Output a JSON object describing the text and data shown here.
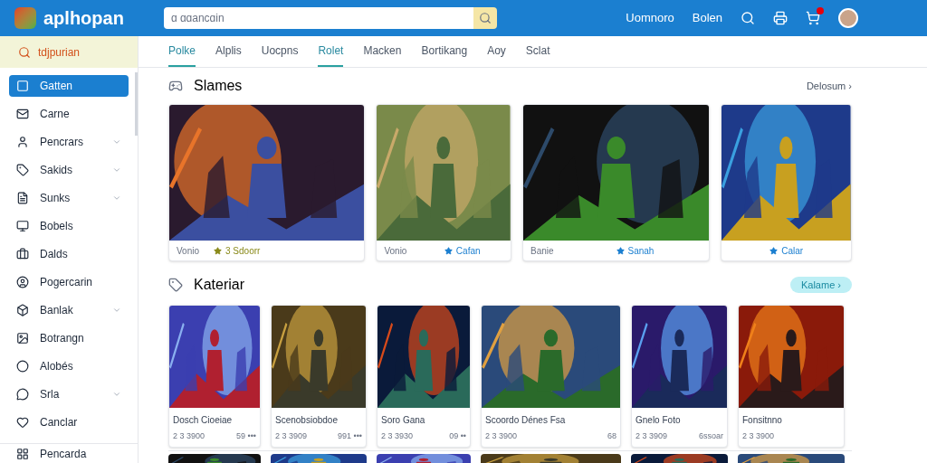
{
  "header": {
    "logo": "aplhopan",
    "search": {
      "placeholder": "ɑ ɑɑancɑin"
    },
    "links": [
      "Uomnoro",
      "Bolen"
    ],
    "cart_badge": true
  },
  "sidebar": {
    "top": "tdjpurian",
    "items": [
      {
        "label": "Gatten",
        "selected": true,
        "expandable": false
      },
      {
        "label": "Carne",
        "selected": false,
        "expandable": false
      },
      {
        "label": "Pencrars",
        "selected": false,
        "expandable": true
      },
      {
        "label": "Sakids",
        "selected": false,
        "expandable": true
      },
      {
        "label": "Sunks",
        "selected": false,
        "expandable": true
      },
      {
        "label": "Bobels",
        "selected": false,
        "expandable": false
      },
      {
        "label": "Dalds",
        "selected": false,
        "expandable": false
      },
      {
        "label": "Pogercarin",
        "selected": false,
        "expandable": false
      },
      {
        "label": "Banlak",
        "selected": false,
        "expandable": true
      },
      {
        "label": "Botrangn",
        "selected": false,
        "expandable": false
      },
      {
        "label": "Alobés",
        "selected": false,
        "expandable": false
      },
      {
        "label": "Srla",
        "selected": false,
        "expandable": true
      },
      {
        "label": "Canclar",
        "selected": false,
        "expandable": false
      }
    ],
    "footer": "Pencarda"
  },
  "tabs": [
    {
      "label": "Polke",
      "selected": true
    },
    {
      "label": "Alplis",
      "selected": false
    },
    {
      "label": "Uocpns",
      "selected": false
    },
    {
      "label": "Rolet",
      "selected": true
    },
    {
      "label": "Macken",
      "selected": false
    },
    {
      "label": "Bortikang",
      "selected": false
    },
    {
      "label": "Aoy",
      "selected": false
    },
    {
      "label": "Sclat",
      "selected": false
    }
  ],
  "featured": {
    "title": "Slames",
    "link": "Delosum ›",
    "cards": [
      {
        "label": "Vonio",
        "rating": "3 Sdoorr"
      },
      {
        "label": "Vonio",
        "rating": "Cafan"
      },
      {
        "label": "Banie",
        "rating": "Sanah"
      },
      {
        "rating": "Calar"
      }
    ]
  },
  "category": {
    "title": "Kateriar",
    "button": "Kalame ›",
    "cards": [
      {
        "title": "Dosch Cioeiae",
        "count": "2 3 3900",
        "extra": "59 •••"
      },
      {
        "title": "Scenobsiobdoe",
        "count": "2 3 3909",
        "extra": "991 •••"
      },
      {
        "title": "Soro Gana",
        "count": "2 3 3930",
        "extra": "09 ••"
      },
      {
        "title": "Scoordo Dénes Fsa",
        "count": "2 3 3900",
        "extra": "68"
      },
      {
        "title": "Gnelo Foto",
        "count": "2 3 3909",
        "extra": "6ssoar"
      },
      {
        "title": "Fonsitnno",
        "count": "2 3 3900"
      }
    ]
  }
}
